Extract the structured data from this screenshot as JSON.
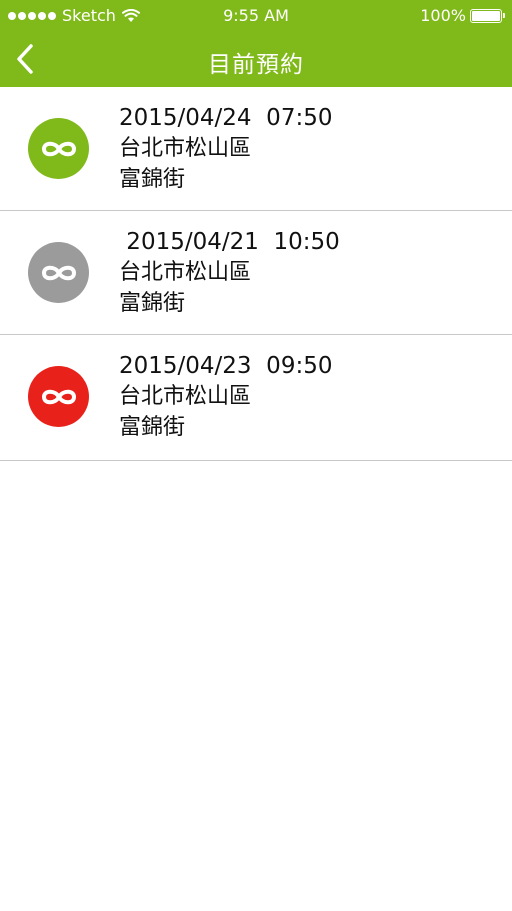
{
  "status_bar": {
    "carrier": "Sketch",
    "time": "9:55 AM",
    "battery": "100%"
  },
  "nav": {
    "title": "目前預約",
    "back_icon": "chevron-left-icon"
  },
  "colors": {
    "accent": "#80b91a",
    "status_green": "#80b91a",
    "status_gray": "#9b9b9b",
    "status_red": "#e8221b"
  },
  "reservations": [
    {
      "datetime": "2015/04/24  07:50",
      "district": "台北市松山區",
      "street": "富錦街",
      "status_color": "#80b91a",
      "icon": "infinity-icon"
    },
    {
      "datetime": " 2015/04/21  10:50",
      "district": "台北市松山區",
      "street": "富錦街",
      "status_color": "#9b9b9b",
      "icon": "infinity-icon"
    },
    {
      "datetime": "2015/04/23  09:50",
      "district": "台北市松山區",
      "street": "富錦街",
      "status_color": "#e8221b",
      "icon": "infinity-icon"
    }
  ]
}
